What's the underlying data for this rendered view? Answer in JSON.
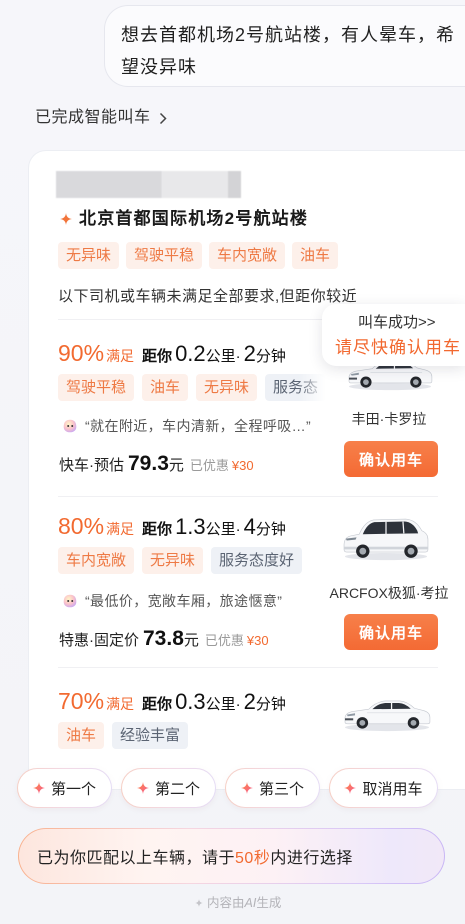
{
  "theme": {
    "accent": "#f26a30",
    "tag_bg": "#fdf0ea",
    "tag_text": "#ee7a45",
    "neutral_tag_bg": "#eef1f6",
    "neutral_tag_text": "#5b6473",
    "button_bg": "#f46a34"
  },
  "icons": {
    "status_link": "chevron-right-icon",
    "destination": "sparkle-icon",
    "quote_avatar": "smile-emoji-icon",
    "quick_reply": "sparkle-icon",
    "footer": "sparkle-icon",
    "vehicle": "car-image"
  },
  "user_message": "想去首都机场2号航站楼，有人晕车，希望没异味",
  "status_link": "已完成智能叫车",
  "card": {
    "destination": "北京首都国际机场2号航站楼",
    "requirement_tags": [
      "无异味",
      "驾驶平稳",
      "车内宽敞",
      "油车"
    ],
    "notice": "以下司机或车辆未满足全部要求,但距你较近",
    "drivers": [
      {
        "match_pct": "90%",
        "match_label": "满足",
        "distance_label": "距你",
        "distance": "0.2",
        "distance_unit": "公里",
        "separator": "·",
        "eta": "2",
        "eta_unit": "分钟",
        "tags": [
          {
            "text": "驾驶平稳",
            "met": true
          },
          {
            "text": "油车",
            "met": true
          },
          {
            "text": "无异味",
            "met": true
          },
          {
            "text": "服务态",
            "met": false
          }
        ],
        "car_model": "丰田·卡罗拉",
        "quote": "“就在附近，车内清新，全程呼吸…”",
        "price_label": "快车·预估",
        "price": "79.3",
        "price_unit": "元",
        "discount_label": "已优惠",
        "discount": "¥30",
        "confirm_label": "确认用车"
      },
      {
        "match_pct": "80%",
        "match_label": "满足",
        "distance_label": "距你",
        "distance": "1.3",
        "distance_unit": "公里",
        "separator": "·",
        "eta": "4",
        "eta_unit": "分钟",
        "tags": [
          {
            "text": "车内宽敞",
            "met": true
          },
          {
            "text": "无异味",
            "met": true
          },
          {
            "text": "服务态度好",
            "met": false
          }
        ],
        "car_model": "ARCFOX极狐·考拉",
        "quote": "“最低价，宽敞车厢，旅途惬意”",
        "price_label": "特惠·固定价",
        "price": "73.8",
        "price_unit": "元",
        "discount_label": "已优惠",
        "discount": "¥30",
        "confirm_label": "确认用车"
      },
      {
        "match_pct": "70%",
        "match_label": "满足",
        "distance_label": "距你",
        "distance": "0.3",
        "distance_unit": "公里",
        "separator": "·",
        "eta": "2",
        "eta_unit": "分钟",
        "tags": [
          {
            "text": "油车",
            "met": true
          },
          {
            "text": "经验丰富",
            "met": false
          }
        ]
      }
    ]
  },
  "popup": {
    "title": "叫车成功>>",
    "subtitle": "请尽快确认用车"
  },
  "quick_replies": [
    "第一个",
    "第二个",
    "第三个",
    "取消用车"
  ],
  "banner": {
    "prefix": "已为你匹配以上车辆，请于",
    "highlight": "50秒",
    "suffix": "内进行选择"
  },
  "footer": {
    "prefix": "内容由",
    "ai": "AI",
    "suffix": "生成"
  }
}
